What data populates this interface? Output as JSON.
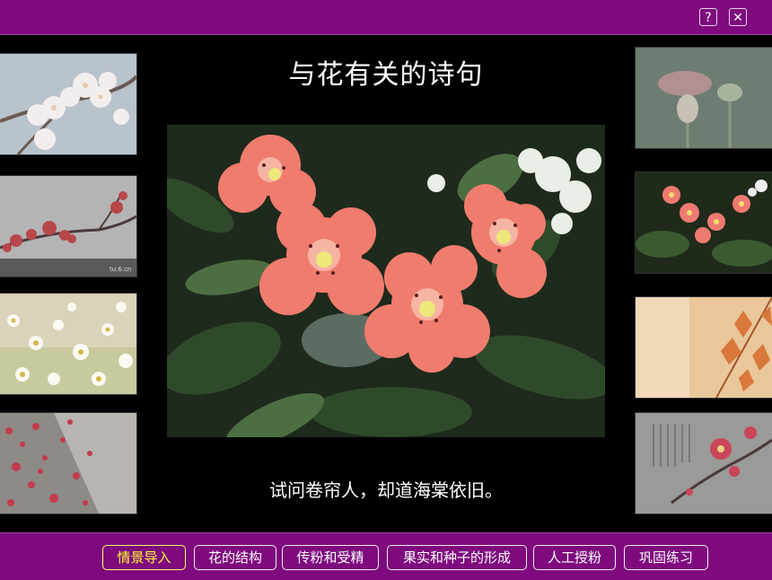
{
  "header": {
    "help_label": "?",
    "close_label": "✕"
  },
  "title": "与花有关的诗句",
  "caption": "试问卷帘人，却道海棠依旧。",
  "main_image": {
    "icon": "rhododendron-photo"
  },
  "thumbnails": {
    "left": [
      "plum-blossom-white-photo",
      "red-plum-branch-photo",
      "daisy-field-photo",
      "petals-path-photo"
    ],
    "right": [
      "lotus-bud-photo",
      "pink-flowers-photo",
      "autumn-leaves-photo",
      "plum-calligraphy-photo"
    ]
  },
  "nav": {
    "items": [
      {
        "label": "情景导入",
        "active": true
      },
      {
        "label": "花的结构",
        "active": false
      },
      {
        "label": "传粉和受精",
        "active": false
      },
      {
        "label": "果实和种子的形成",
        "active": false
      },
      {
        "label": "人工授粉",
        "active": false
      },
      {
        "label": "巩固练习",
        "active": false
      }
    ]
  },
  "colors": {
    "bar": "#7e0a7e",
    "active_text": "#ffff33",
    "background": "#000000"
  }
}
